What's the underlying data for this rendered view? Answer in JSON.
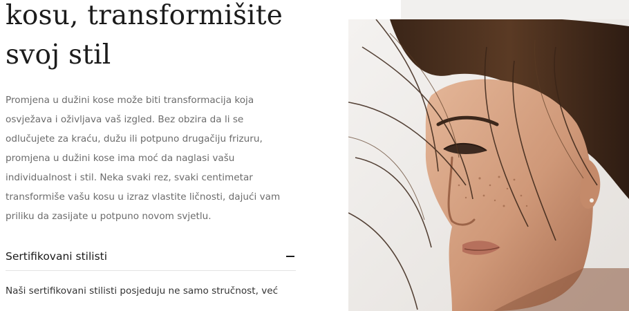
{
  "hero": {
    "headline_line1": "kosu, transformišite",
    "headline_line2": "svoj stil",
    "paragraph_lines": [
      "Promjena u dužini kose može biti transformacija koja",
      "osvježava i oživljava vaš izgled. Bez obzira da li se",
      "odlučujete za kraću, dužu ili potpuno drugačiju frizuru,",
      "promjena u dužini kose ima moć da naglasi vašu",
      "individualnost i stil. Neka svaki rez, svaki centimetar",
      "transformiše vašu kosu u izraz vlastite ličnosti, dajući vam",
      "priliku da zasijate u potpuno novom svjetlu."
    ]
  },
  "accordion": {
    "title": "Sertifikovani stilisti",
    "toggle_icon": "minus-icon",
    "body": "Naši sertifikovani stilisti posjeduju ne samo stručnost, već"
  },
  "colors": {
    "headline": "#1c1c1c",
    "paragraph": "#6b6b6b",
    "panel": "#f1f0ee"
  }
}
